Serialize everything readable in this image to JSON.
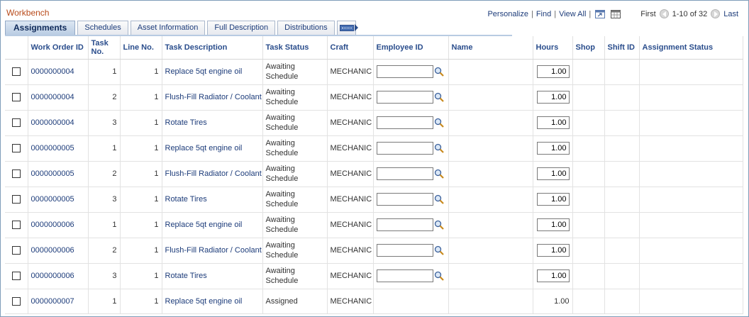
{
  "grid": {
    "title": "Workbench",
    "nav": {
      "personalize": "Personalize",
      "find": "Find",
      "view_all": "View All",
      "first": "First",
      "range": "1-10 of 32",
      "last": "Last"
    }
  },
  "tabs": [
    {
      "label": "Assignments",
      "active": true
    },
    {
      "label": "Schedules",
      "active": false
    },
    {
      "label": "Asset Information",
      "active": false
    },
    {
      "label": "Full Description",
      "active": false
    },
    {
      "label": "Distributions",
      "active": false
    }
  ],
  "columns": {
    "work_order_id": "Work Order ID",
    "task_no": "Task No.",
    "line_no": "Line No.",
    "task_description": "Task Description",
    "task_status": "Task Status",
    "craft": "Craft",
    "employee_id": "Employee ID",
    "name": "Name",
    "hours": "Hours",
    "shop": "Shop",
    "shift_id": "Shift ID",
    "assignment_status": "Assignment Status"
  },
  "rows": [
    {
      "wo": "0000000004",
      "task": "1",
      "line": "1",
      "desc": "Replace 5qt engine oil",
      "status": "Awaiting Schedule",
      "craft": "MECHANIC",
      "emp": "",
      "name": "",
      "hours": "1.00",
      "editable": true,
      "shop": "",
      "shift": "",
      "assign_status": ""
    },
    {
      "wo": "0000000004",
      "task": "2",
      "line": "1",
      "desc": "Flush-Fill Radiator / Coolant",
      "status": "Awaiting Schedule",
      "craft": "MECHANIC",
      "emp": "",
      "name": "",
      "hours": "1.00",
      "editable": true,
      "shop": "",
      "shift": "",
      "assign_status": ""
    },
    {
      "wo": "0000000004",
      "task": "3",
      "line": "1",
      "desc": "Rotate Tires",
      "status": "Awaiting Schedule",
      "craft": "MECHANIC",
      "emp": "",
      "name": "",
      "hours": "1.00",
      "editable": true,
      "shop": "",
      "shift": "",
      "assign_status": ""
    },
    {
      "wo": "0000000005",
      "task": "1",
      "line": "1",
      "desc": "Replace 5qt engine oil",
      "status": "Awaiting Schedule",
      "craft": "MECHANIC",
      "emp": "",
      "name": "",
      "hours": "1.00",
      "editable": true,
      "shop": "",
      "shift": "",
      "assign_status": ""
    },
    {
      "wo": "0000000005",
      "task": "2",
      "line": "1",
      "desc": "Flush-Fill Radiator / Coolant",
      "status": "Awaiting Schedule",
      "craft": "MECHANIC",
      "emp": "",
      "name": "",
      "hours": "1.00",
      "editable": true,
      "shop": "",
      "shift": "",
      "assign_status": ""
    },
    {
      "wo": "0000000005",
      "task": "3",
      "line": "1",
      "desc": "Rotate Tires",
      "status": "Awaiting Schedule",
      "craft": "MECHANIC",
      "emp": "",
      "name": "",
      "hours": "1.00",
      "editable": true,
      "shop": "",
      "shift": "",
      "assign_status": ""
    },
    {
      "wo": "0000000006",
      "task": "1",
      "line": "1",
      "desc": "Replace 5qt engine oil",
      "status": "Awaiting Schedule",
      "craft": "MECHANIC",
      "emp": "",
      "name": "",
      "hours": "1.00",
      "editable": true,
      "shop": "",
      "shift": "",
      "assign_status": ""
    },
    {
      "wo": "0000000006",
      "task": "2",
      "line": "1",
      "desc": "Flush-Fill Radiator / Coolant",
      "status": "Awaiting Schedule",
      "craft": "MECHANIC",
      "emp": "",
      "name": "",
      "hours": "1.00",
      "editable": true,
      "shop": "",
      "shift": "",
      "assign_status": ""
    },
    {
      "wo": "0000000006",
      "task": "3",
      "line": "1",
      "desc": "Rotate Tires",
      "status": "Awaiting Schedule",
      "craft": "MECHANIC",
      "emp": "",
      "name": "",
      "hours": "1.00",
      "editable": true,
      "shop": "",
      "shift": "",
      "assign_status": ""
    },
    {
      "wo": "0000000007",
      "task": "1",
      "line": "1",
      "desc": "Replace 5qt engine oil",
      "status": "Assigned",
      "craft": "MECHANIC",
      "emp": "",
      "name": "",
      "hours": "1.00",
      "editable": false,
      "shop": "",
      "shift": "",
      "assign_status": ""
    }
  ],
  "colors": {
    "title": "#b84a1a",
    "link": "#1d3c7a",
    "header": "#2a4d8c",
    "active_tab": "#b8cbe2"
  }
}
